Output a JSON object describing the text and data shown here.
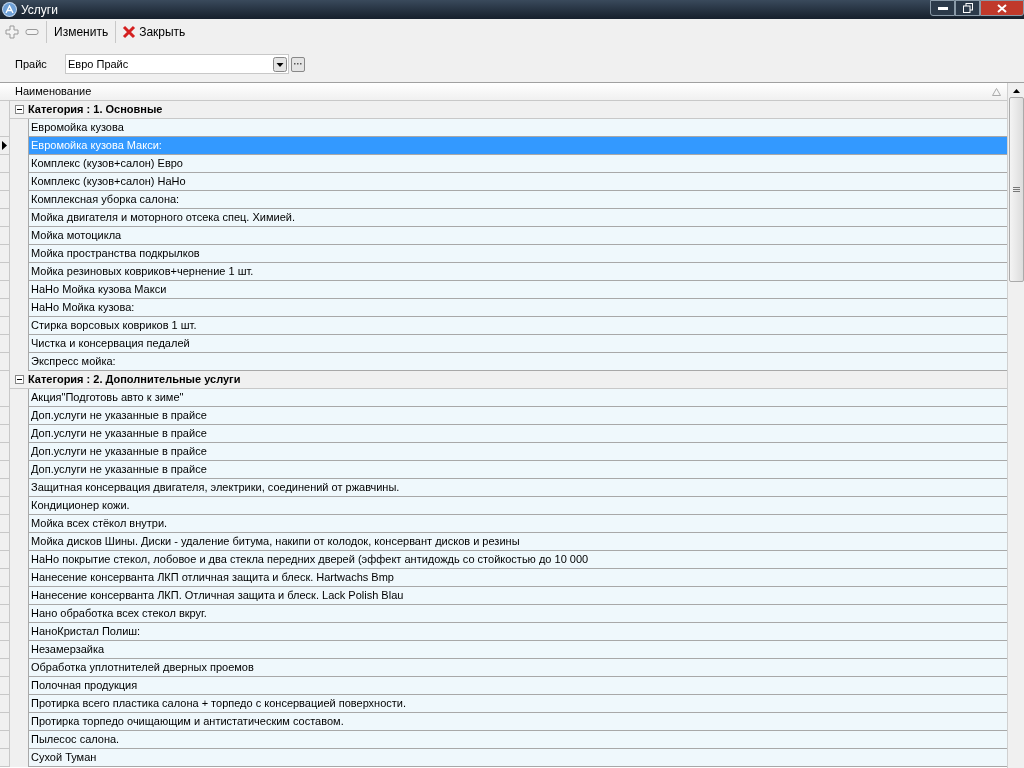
{
  "window": {
    "title": "Услуги"
  },
  "toolbar": [
    {
      "kind": "add"
    },
    {
      "kind": "remove"
    },
    {
      "kind": "text",
      "label": "Изменить"
    },
    {
      "kind": "close",
      "label": "Закрыть"
    }
  ],
  "price": {
    "label": "Прайс",
    "value": "Евро Прайс"
  },
  "table": {
    "column": "Наименование",
    "groups": [
      {
        "title": "Категория :  1. Основные",
        "expanded": true,
        "rows": [
          {
            "name": "Евромойка кузова",
            "selected": false
          },
          {
            "name": "Евромойка кузова Макси:",
            "selected": true
          },
          {
            "name": "Комплекс (кузов+салон) Евро",
            "selected": false
          },
          {
            "name": "Комплекс (кузов+салон) НаНо",
            "selected": false
          },
          {
            "name": "Комплексная уборка салона:",
            "selected": false
          },
          {
            "name": "Мойка двигателя и моторного отсека спец. Химией.",
            "selected": false
          },
          {
            "name": "Мойка мотоцикла",
            "selected": false
          },
          {
            "name": "Мойка пространства подкрылков",
            "selected": false
          },
          {
            "name": "Мойка резиновых ковриков+чернение 1 шт.",
            "selected": false
          },
          {
            "name": "НаНо Мойка кузова Макси",
            "selected": false
          },
          {
            "name": "НаНо Мойка кузова:",
            "selected": false
          },
          {
            "name": "Стирка ворсовых ковриков 1 шт.",
            "selected": false
          },
          {
            "name": "Чистка и консервация педалей",
            "selected": false
          },
          {
            "name": "Экспресс мойка:",
            "selected": false
          }
        ]
      },
      {
        "title": "Категория :  2. Дополнительные услуги",
        "expanded": true,
        "rows": [
          {
            "name": "Акция\"Подготовь авто к зиме\"",
            "selected": false
          },
          {
            "name": "Доп.услуги не указанные в прайсе",
            "selected": false
          },
          {
            "name": "Доп.услуги не указанные в прайсе",
            "selected": false
          },
          {
            "name": "Доп.услуги не указанные в прайсе",
            "selected": false
          },
          {
            "name": "Доп.услуги не указанные в прайсе",
            "selected": false
          },
          {
            "name": "Защитная консервация двигателя, электрики, соединений от ржавчины.",
            "selected": false
          },
          {
            "name": "Кондиционер кожи.",
            "selected": false
          },
          {
            "name": "Мойка всех стёкол внутри.",
            "selected": false
          },
          {
            "name": "Мойка дисков Шины. Диски - удаление битума, накипи от колодок, консервант дисков и резины",
            "selected": false
          },
          {
            "name": "НаНо покрытие стекол, лобовое и два стекла передних дверей (эффект антидождь со стойкостью до 10 000",
            "selected": false
          },
          {
            "name": "Нанесение консерванта ЛКП отличная защита и блеск. Hartwachs Bmp",
            "selected": false
          },
          {
            "name": "Нанесение консерванта ЛКП. Отличная защита и блеск. Lack Polish Blau",
            "selected": false
          },
          {
            "name": "Нано обработка всех стекол вкруг.",
            "selected": false
          },
          {
            "name": "НаноКристал Полиш:",
            "selected": false
          },
          {
            "name": "Незамерзайка",
            "selected": false
          },
          {
            "name": "Обработка уплотнителей дверных проемов",
            "selected": false
          },
          {
            "name": "Полочная продукция",
            "selected": false
          },
          {
            "name": "Протирка всего пластика салона + торпедо с консервацией поверхности.",
            "selected": false
          },
          {
            "name": "Протирка торпедо очищающим и антистатическим составом.",
            "selected": false
          },
          {
            "name": "Пылесос салона.",
            "selected": false
          },
          {
            "name": "Сухой Туман",
            "selected": false
          }
        ]
      }
    ]
  }
}
